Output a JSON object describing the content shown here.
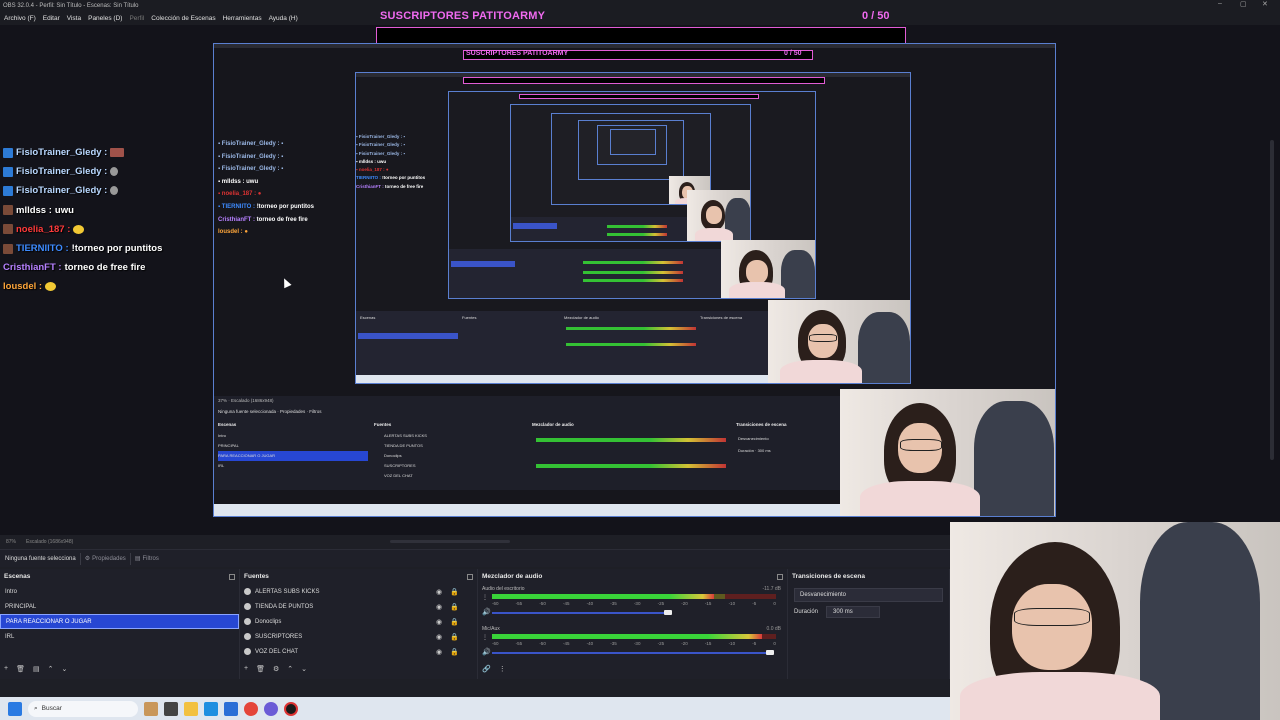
{
  "window": {
    "title": "OBS 32.0.4 - Perfil: Sin Título - Escenas: Sin Título"
  },
  "menu": {
    "items": [
      "Archivo (F)",
      "Editar",
      "Vista",
      "Paneles (D)",
      "Perfil",
      "Colección de Escenas",
      "Herramientas",
      "Ayuda (H)"
    ]
  },
  "overlay": {
    "sub_goal_title": "SUSCRIPTORES PATITOARMY",
    "sub_goal_count": "0 / 50"
  },
  "chat": [
    {
      "user": "FisioTrainer_Gledy :",
      "message": "",
      "user_color": "#b9d8ff",
      "badge": "tw",
      "emote": "box"
    },
    {
      "user": "FisioTrainer_Gledy :",
      "message": "",
      "user_color": "#b9d8ff",
      "badge": "tw",
      "emote": "grey"
    },
    {
      "user": "FisioTrainer_Gledy :",
      "message": "",
      "user_color": "#b9d8ff",
      "badge": "tw",
      "emote": "grey"
    },
    {
      "user": "mlldss :",
      "message": "uwu",
      "user_color": "#ffffff",
      "badge": "br",
      "emote": ""
    },
    {
      "user": "noelia_187 :",
      "message": "",
      "user_color": "#ff3a3a",
      "badge": "br",
      "emote": "yellow"
    },
    {
      "user": "TIERNIITO :",
      "message": "!torneo por puntitos",
      "user_color": "#3d8bff",
      "badge": "br",
      "emote": ""
    },
    {
      "user": "CristhianFT :",
      "message": "torneo de free fire",
      "user_color": "#b680ff",
      "badge": "",
      "emote": ""
    },
    {
      "user": "lousdel :",
      "message": "",
      "user_color": "#ffa63a",
      "badge": "",
      "emote": "yellow"
    }
  ],
  "status": {
    "zoom": "87%",
    "scaling": "Escalado (1686x948)"
  },
  "toolbar": {
    "no_source": "Ninguna fuente selecciona",
    "properties": "Propiedades",
    "filters": "Filtros"
  },
  "scenes": {
    "title": "Escenas",
    "items": [
      "Intro",
      "PRINCIPAL",
      "PARA REACCIONAR O JUGAR",
      "IRL"
    ],
    "selected_index": 2
  },
  "sources": {
    "title": "Fuentes",
    "items": [
      "ALERTAS SUBS KICKS",
      "TIENDA DE PUNTOS",
      "Donoclips",
      "SUSCRIPTORES",
      "VOZ DEL CHAT"
    ]
  },
  "mixer": {
    "title": "Mezclador de audio",
    "channels": [
      {
        "name": "Audio del escritorio",
        "db": "-11.7 dB",
        "level": 0.78,
        "fader": 0.62
      },
      {
        "name": "Mic/Aux",
        "db": "0.0 dB",
        "level": 0.95,
        "fader": 0.98
      }
    ],
    "scale": [
      "-60",
      "-55",
      "-50",
      "-45",
      "-40",
      "-35",
      "-30",
      "-25",
      "-20",
      "-15",
      "-10",
      "-5",
      "0"
    ]
  },
  "transitions": {
    "title": "Transiciones de escena",
    "selected": "Desvanecimiento",
    "duration_label": "Duración",
    "duration_value": "300 ms"
  },
  "taskbar": {
    "search_placeholder": "Buscar"
  },
  "colors": {
    "accent": "#2747d3",
    "overlay_pink": "#f06af0",
    "bg": "#1f2029"
  }
}
